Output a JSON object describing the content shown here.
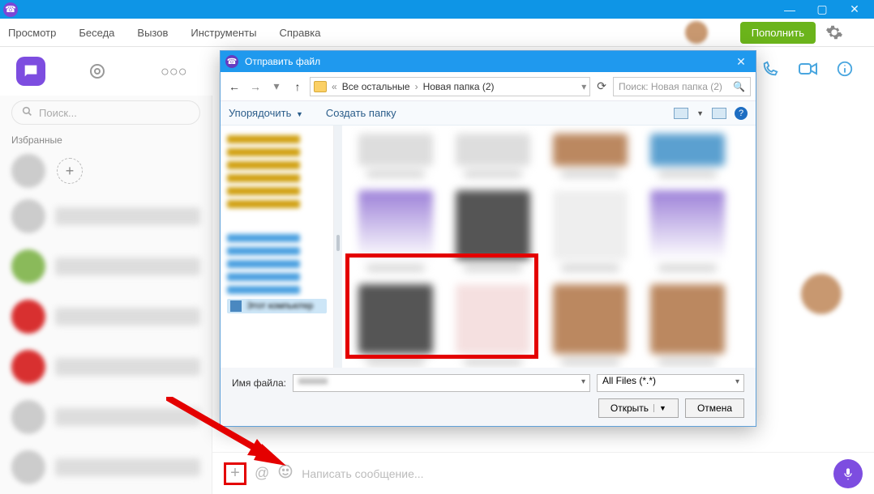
{
  "titlebar": {
    "min": "—",
    "max": "▢",
    "close": "✕"
  },
  "menu": {
    "view": "Просмотр",
    "chat": "Беседа",
    "call": "Вызов",
    "tools": "Инструменты",
    "help": "Справка",
    "topup": "Пополнить"
  },
  "sidebar": {
    "search_placeholder": "Поиск...",
    "favorites": "Избранные"
  },
  "composer": {
    "placeholder": "Написать сообщение...",
    "at": "@"
  },
  "dialog": {
    "title": "Отправить файл",
    "crumb1": "Все остальные",
    "crumb2": "Новая папка (2)",
    "search_placeholder": "Поиск: Новая папка (2)",
    "organize": "Упорядочить",
    "newfolder": "Создать папку",
    "tree_selected": "Этот компьютер",
    "fn_label": "Имя файла:",
    "filetype": "All Files (*.*)",
    "open": "Открыть",
    "cancel": "Отмена"
  }
}
